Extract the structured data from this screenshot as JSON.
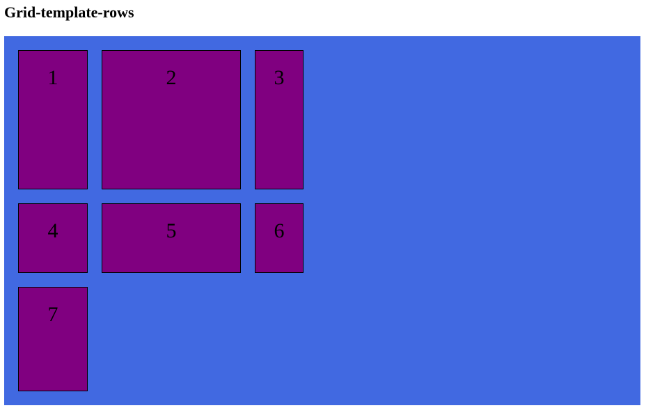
{
  "page": {
    "heading": "Grid-template-rows"
  },
  "grid": {
    "items": [
      {
        "label": "1"
      },
      {
        "label": "2"
      },
      {
        "label": "3"
      },
      {
        "label": "4"
      },
      {
        "label": "5"
      },
      {
        "label": "6"
      },
      {
        "label": "7"
      }
    ]
  },
  "colors": {
    "container": "#4169e1",
    "item": "#800080",
    "item_border": "#000000"
  }
}
